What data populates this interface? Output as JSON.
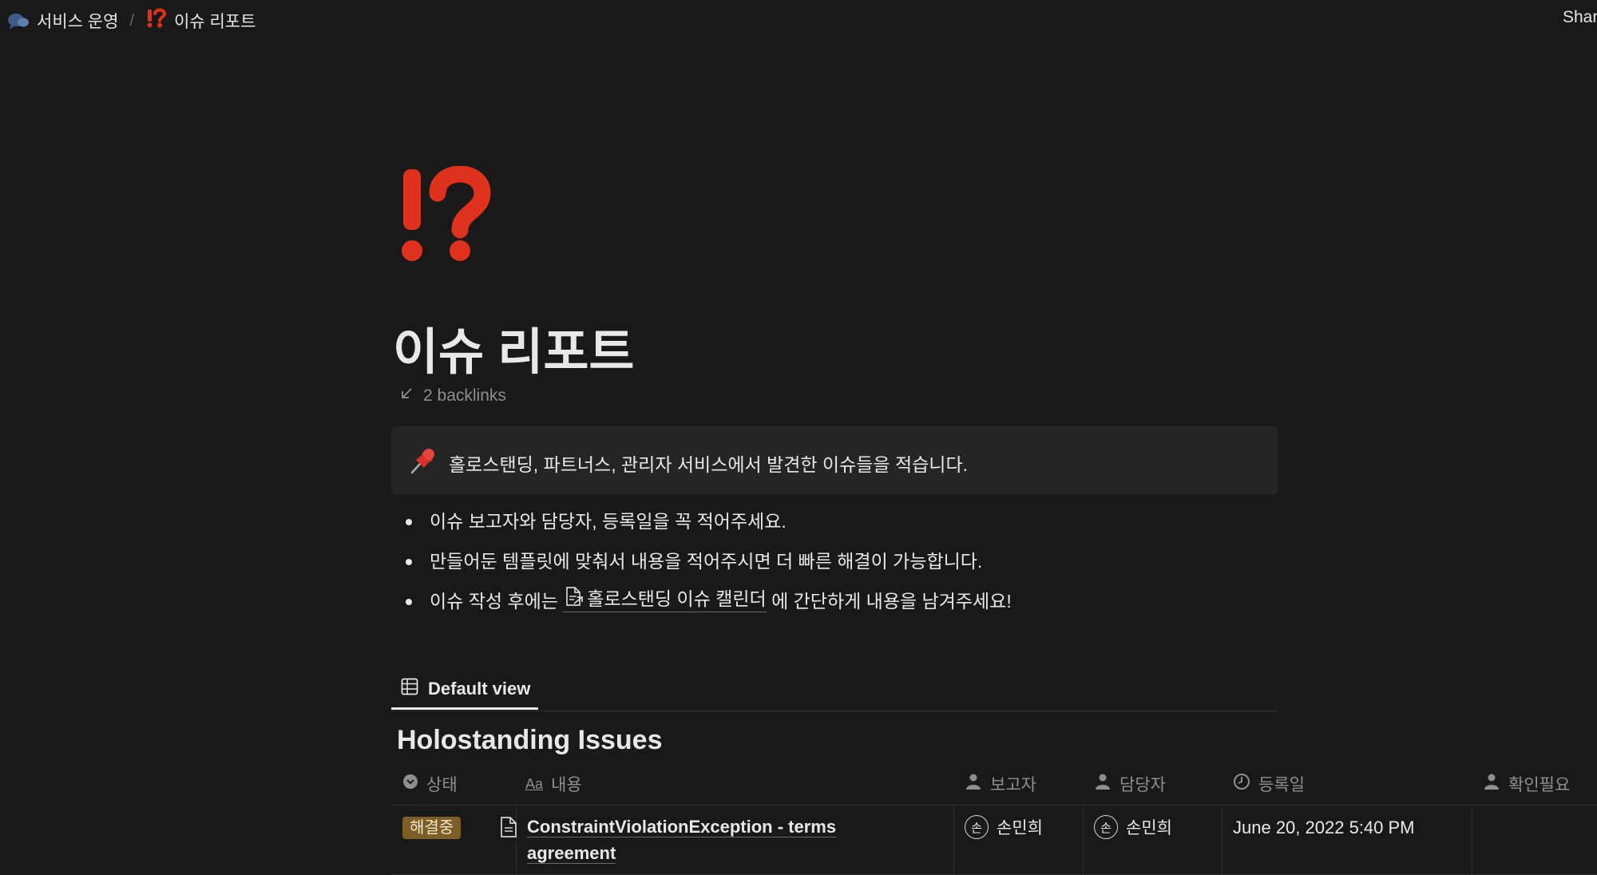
{
  "breadcrumb": {
    "parent_label": "서비스 운영",
    "separator": "/",
    "current_icon": "⁉️",
    "current_label": "이슈 리포트"
  },
  "topbar": {
    "share_label": "Shar"
  },
  "page": {
    "icon": "exclamation-question-mark-icon",
    "title": "이슈 리포트",
    "backlinks_label": "2 backlinks"
  },
  "callout": {
    "icon": "pushpin-icon",
    "text": "홀로스탠딩, 파트너스, 관리자 서비스에서 발견한 이슈들을 적습니다."
  },
  "bullets": {
    "b1": "이슈 보고자와 담당자, 등록일을 꼭 적어주세요.",
    "b2": "만들어둔 템플릿에 맞춰서 내용을 적어주시면 더 빠른 해결이 가능합니다.",
    "b3_prefix": "이슈 작성 후에는 ",
    "b3_link": "홀로스탠딩 이슈 캘린더",
    "b3_suffix": " 에 간단하게 내용을 남겨주세요!"
  },
  "database": {
    "view_tab_label": "Default view",
    "title": "Holostanding Issues",
    "columns": {
      "status": "상태",
      "content": "내용",
      "reporter": "보고자",
      "assignee": "담당자",
      "registered": "등록일",
      "confirm_needed": "확인필요"
    },
    "rows": [
      {
        "status": "해결중",
        "content": "ConstraintViolationException - terms agreement",
        "reporter_initial": "손",
        "reporter": "손민희",
        "assignee_initial": "손",
        "assignee": "손민희",
        "registered": "June 20, 2022 5:40 PM",
        "confirm_needed": ""
      }
    ]
  },
  "colors": {
    "background": "#191919",
    "callout_bg": "#252525",
    "status_badge": "#7d5e26",
    "icon_red": "#e0311c"
  }
}
